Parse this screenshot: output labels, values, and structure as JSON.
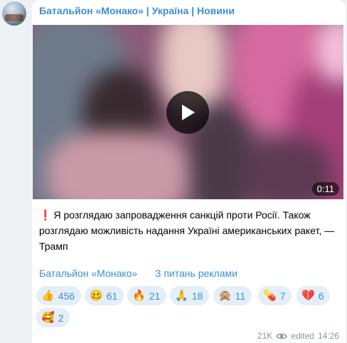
{
  "channel": {
    "name": "Батальйон «Монако» | Україна | Новини"
  },
  "video": {
    "duration": "0:11"
  },
  "message": {
    "exclamation": "❗",
    "text": "Я розглядаю запровадження санкцій проти Росії. Також розглядаю можливість надання Україні американських ракет, — Трамп"
  },
  "signature": {
    "channel": "Батальйон «Монако»",
    "ads": "З питань реклами"
  },
  "reactions": [
    {
      "emoji": "👍",
      "count": "456"
    },
    {
      "emoji": "🥴",
      "count": "61"
    },
    {
      "emoji": "🔥",
      "count": "21"
    },
    {
      "emoji": "🙏",
      "count": "18"
    },
    {
      "emoji": "🙊",
      "count": "11"
    },
    {
      "emoji": "💊",
      "count": "7"
    },
    {
      "emoji": "💔",
      "count": "6"
    },
    {
      "emoji": "🥰",
      "count": "2"
    }
  ],
  "meta": {
    "views": "21K",
    "edited": "edited",
    "time": "14:26"
  }
}
